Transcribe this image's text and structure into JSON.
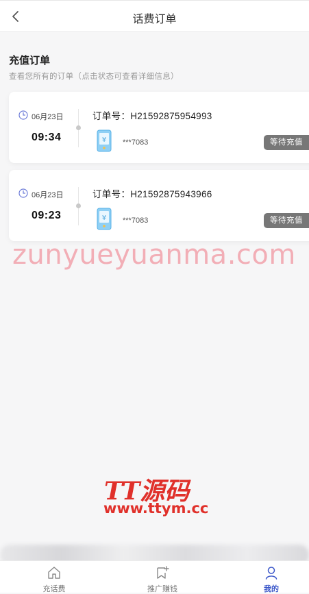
{
  "header": {
    "title": "话费订单"
  },
  "section": {
    "title": "充值订单",
    "subtitle": "查看您所有的订单（点击状态可查看详细信息）"
  },
  "orders": [
    {
      "date": "06月23日",
      "time": "09:34",
      "order_no": "订单号：H21592875954993",
      "phone": "***7083",
      "status": "等待充值"
    },
    {
      "date": "06月23日",
      "time": "09:23",
      "order_no": "订单号：H21592875943966",
      "phone": "***7083",
      "status": "等待充值"
    }
  ],
  "watermarks": {
    "site_text": "zunyueyuanma.com",
    "logo_text": "TT源码",
    "url_text": "www.ttym.cc"
  },
  "tabbar": {
    "items": [
      {
        "label": "充话费",
        "icon": "home-icon"
      },
      {
        "label": "推广赚钱",
        "icon": "promote-icon"
      },
      {
        "label": "我的",
        "icon": "user-icon",
        "active": true
      }
    ]
  },
  "colors": {
    "accent": "#3b57c9",
    "status_bg": "#777777",
    "watermark_red": "#e0302a"
  }
}
